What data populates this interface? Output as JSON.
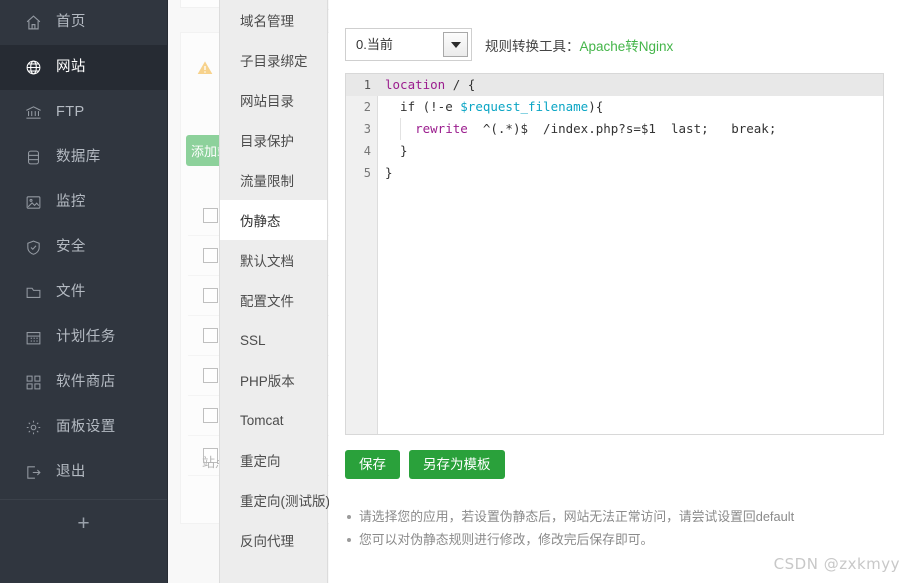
{
  "sidebar": {
    "items": [
      {
        "label": "首页",
        "icon": "home-icon",
        "active": false
      },
      {
        "label": "网站",
        "icon": "globe-icon",
        "active": true
      },
      {
        "label": "FTP",
        "icon": "ftp-icon",
        "active": false
      },
      {
        "label": "数据库",
        "icon": "database-icon",
        "active": false
      },
      {
        "label": "监控",
        "icon": "monitor-icon",
        "active": false
      },
      {
        "label": "安全",
        "icon": "shield-icon",
        "active": false
      },
      {
        "label": "文件",
        "icon": "folder-icon",
        "active": false
      },
      {
        "label": "计划任务",
        "icon": "calendar-icon",
        "active": false
      },
      {
        "label": "软件商店",
        "icon": "apps-icon",
        "active": false
      },
      {
        "label": "面板设置",
        "icon": "gear-icon",
        "active": false
      },
      {
        "label": "退出",
        "icon": "logout-icon",
        "active": false
      }
    ],
    "add_label": "+"
  },
  "submenu": {
    "items": [
      {
        "label": "域名管理",
        "active": false
      },
      {
        "label": "子目录绑定",
        "active": false
      },
      {
        "label": "网站目录",
        "active": false
      },
      {
        "label": "目录保护",
        "active": false
      },
      {
        "label": "流量限制",
        "active": false
      },
      {
        "label": "伪静态",
        "active": true
      },
      {
        "label": "默认文档",
        "active": false
      },
      {
        "label": "配置文件",
        "active": false
      },
      {
        "label": "SSL",
        "active": false
      },
      {
        "label": "PHP版本",
        "active": false
      },
      {
        "label": "Tomcat",
        "active": false
      },
      {
        "label": "重定向",
        "active": false
      },
      {
        "label": "重定向(测试版)",
        "active": false
      },
      {
        "label": "反向代理",
        "active": false
      }
    ]
  },
  "background": {
    "green_button_label": "添加站点",
    "footer_label": "站点总数"
  },
  "toolbar": {
    "select_value": "0.当前",
    "select_options": [
      "0.当前"
    ],
    "converter_label": "规则转换工具：",
    "converter_link": "Apache转Nginx",
    "link_color": "#44b549"
  },
  "editor": {
    "lines": [
      {
        "num": "1",
        "active": true,
        "indent": 0,
        "tokens": [
          {
            "t": "location",
            "c": "kw"
          },
          {
            "t": " / {",
            "c": "plain"
          }
        ]
      },
      {
        "num": "2",
        "active": false,
        "indent": 1,
        "tokens": [
          {
            "t": "  if (!-e ",
            "c": "plain"
          },
          {
            "t": "$request_filename",
            "c": "var"
          },
          {
            "t": "){",
            "c": "plain"
          }
        ]
      },
      {
        "num": "3",
        "active": false,
        "indent": 2,
        "tokens": [
          {
            "t": "    ",
            "c": "plain"
          },
          {
            "t": "rewrite",
            "c": "kw"
          },
          {
            "t": "  ^(.*)$  /index.php?s=$1  last;   break;",
            "c": "plain"
          }
        ]
      },
      {
        "num": "4",
        "active": false,
        "indent": 1,
        "tokens": [
          {
            "t": "  }",
            "c": "plain"
          }
        ]
      },
      {
        "num": "5",
        "active": false,
        "indent": 0,
        "tokens": [
          {
            "t": "}",
            "c": "plain"
          }
        ]
      }
    ]
  },
  "actions": {
    "save_label": "保存",
    "save_template_label": "另存为模板",
    "button_color": "#2aa13b"
  },
  "tips": [
    "请选择您的应用，若设置伪静态后，网站无法正常访问，请尝试设置回default",
    "您可以对伪静态规则进行修改，修改完后保存即可。"
  ],
  "watermark": "CSDN @zxkmyy"
}
